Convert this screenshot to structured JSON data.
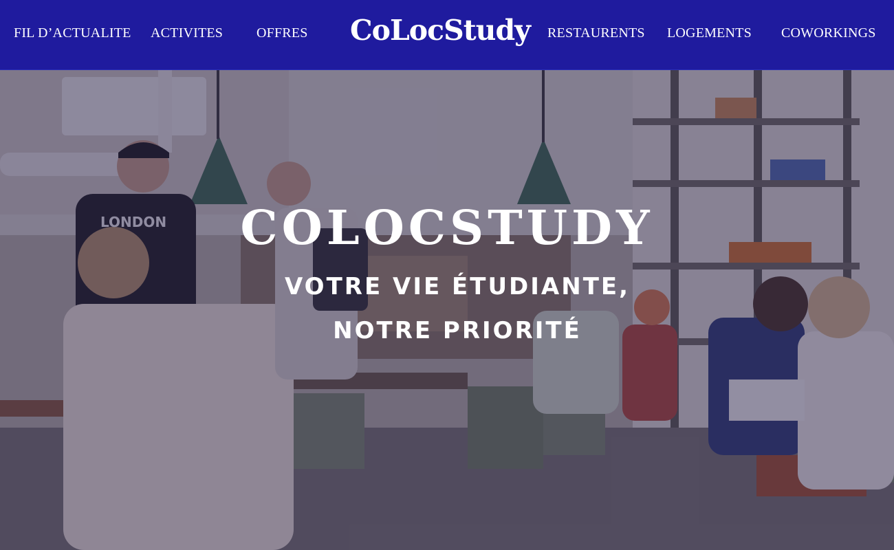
{
  "header": {
    "brand": "CoLocStudy",
    "nav_left": [
      {
        "label": "FIL D’ACTUALITE"
      },
      {
        "label": "ACTIVITES"
      },
      {
        "label": "OFFRES"
      }
    ],
    "nav_right": [
      {
        "label": "RESTAURENTS"
      },
      {
        "label": "LOGEMENTS"
      },
      {
        "label": "COWORKINGS"
      }
    ]
  },
  "hero": {
    "title": "COLOCSTUDY",
    "subtitle": "VOTRE VIE ÉTUDIANTE, NOTRE PRIORITÉ",
    "shirt_text": "LONDON",
    "image_description": ""
  },
  "colors": {
    "header_bg": "#1f1b9e",
    "text": "#ffffff",
    "overlay": "#261e4a"
  }
}
